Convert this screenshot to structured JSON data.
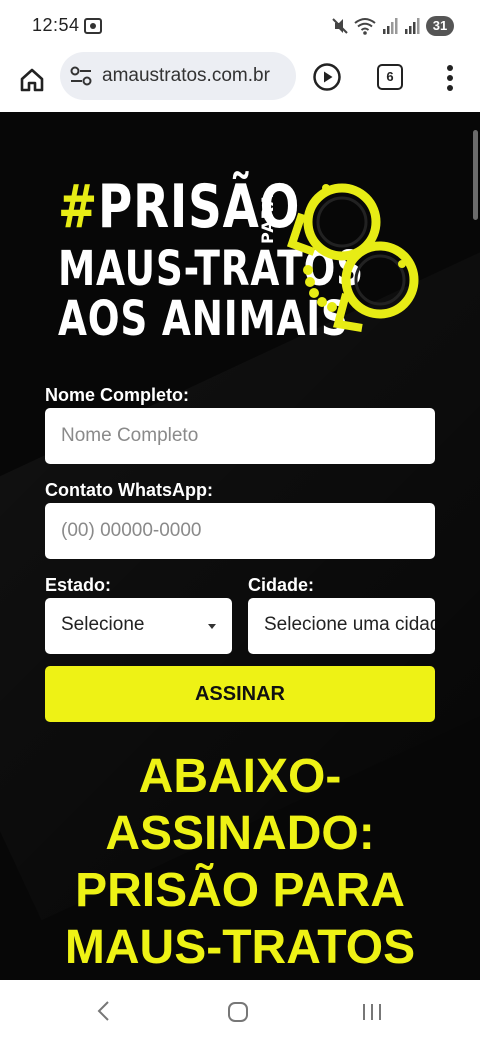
{
  "status_bar": {
    "time": "12:54",
    "battery": "31",
    "icons": [
      "screen-record-icon",
      "mute-icon",
      "wifi-icon",
      "signal-icon",
      "signal-icon"
    ]
  },
  "browser": {
    "url": "amaustratos.com.br",
    "tab_count": "6",
    "icons": [
      "home-icon",
      "site-settings-icon",
      "play-icon",
      "tabs-icon",
      "more-vert-icon"
    ]
  },
  "logo": {
    "hash": "#",
    "line1": "PRISÃO",
    "para": "PARA",
    "line2": "MAUS-TRATOS",
    "line3": "AOS ANIMAIS",
    "image": "handcuffs-icon"
  },
  "form": {
    "name_label": "Nome Completo:",
    "name_placeholder": "Nome Completo",
    "whatsapp_label": "Contato WhatsApp:",
    "whatsapp_placeholder": "(00) 00000-0000",
    "state_label": "Estado:",
    "state_value": "Selecione",
    "city_label": "Cidade:",
    "city_value": "Selecione uma cidade",
    "submit_label": "ASSINAR"
  },
  "headline": {
    "line1": "ABAIXO-",
    "line2": "ASSINADO:",
    "line3": "PRISÃO PARA",
    "line4": "MAUS-TRATOS"
  },
  "colors": {
    "accent": "#eef215",
    "page_background": "#070707",
    "text_light": "#ffffff"
  },
  "nav": {
    "icons": [
      "back-icon",
      "home-circle-icon",
      "recents-icon"
    ]
  }
}
